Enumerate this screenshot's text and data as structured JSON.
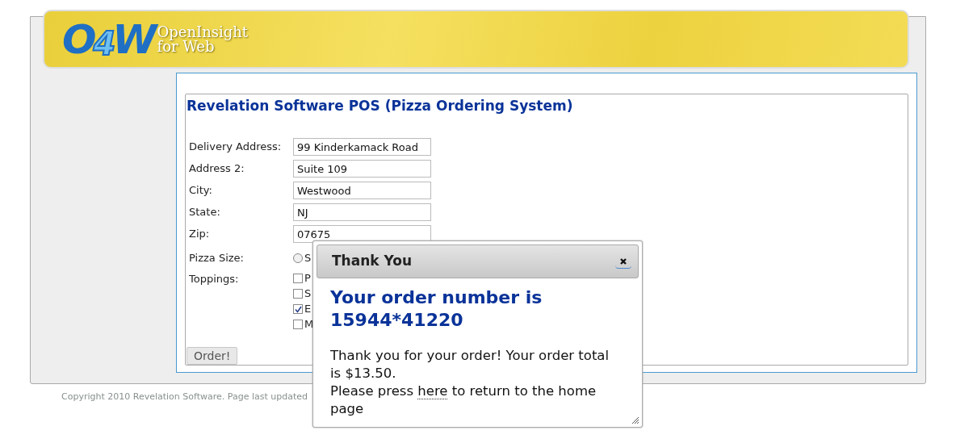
{
  "logo": {
    "mark_left": "O",
    "mark_digit": "4",
    "mark_right": "W",
    "line_1": "OpenInsight",
    "line_2": "for Web"
  },
  "form": {
    "title": "Revelation Software POS (Pizza Ordering System)",
    "fields": [
      {
        "label": "Delivery Address:",
        "value": "99 Kinderkamack Road"
      },
      {
        "label": "Address 2:",
        "value": "Suite 109"
      },
      {
        "label": "City:",
        "value": "Westwood"
      },
      {
        "label": "State:",
        "value": "NJ"
      },
      {
        "label": "Zip:",
        "value": "07675"
      }
    ],
    "pizza_size": {
      "label": "Pizza Size:",
      "options": [
        {
          "label": "S",
          "selected": false
        }
      ]
    },
    "toppings": {
      "label": "Toppings:",
      "items": [
        {
          "label": "P",
          "checked": false
        },
        {
          "label": "S",
          "checked": false
        },
        {
          "label": "E",
          "checked": true
        },
        {
          "label": "M",
          "checked": false
        }
      ]
    },
    "order_button": "Order!"
  },
  "footer": "Copyright 2010 Revelation Software. Page last updated",
  "dialog": {
    "title": "Thank You",
    "heading": "Your order number is 15944*41220",
    "message": "Thank you for your order! Your order total is $13.50.",
    "prompt_before": "Please press",
    "link": "here",
    "prompt_after": "to return to the home page"
  }
}
